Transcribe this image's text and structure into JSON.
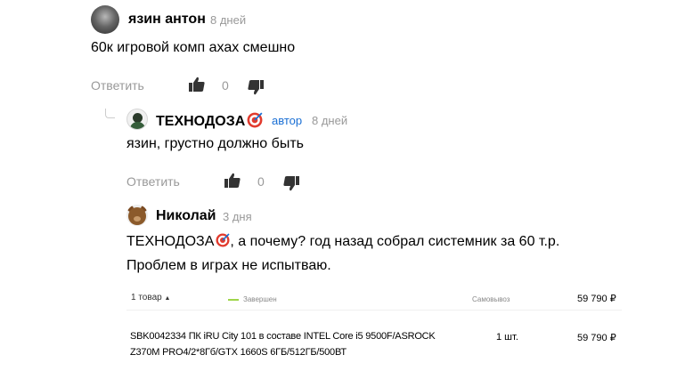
{
  "comments": [
    {
      "author": "язин антон",
      "date": "8 дней",
      "text": "60к игровой комп ахах смешно",
      "reply_label": "Ответить",
      "likes": "0"
    },
    {
      "author": "ТЕХНОДОЗА",
      "badge": "автор",
      "date": "8 дней",
      "text": "язин, грустно должно быть",
      "reply_label": "Ответить",
      "likes": "0"
    },
    {
      "author": "Николай",
      "date": "3 дня",
      "text_line1_prefix": "ТЕХНОДОЗА",
      "text_line1_suffix": ", а почему? год назад собрал системник за 60 т.р.",
      "text_line2": "Проблем в играх не испытваю.",
      "attachment": {
        "summary_count": "1 товар",
        "status": "Завершен",
        "delivery": "Самовывоз",
        "summary_price": "59 790 ₽",
        "item_line1": "SBK0042334 ПК iRU City 101 в составе INTEL Core i5 9500F/ASROCK",
        "item_line2": "Z370M PRO4/2*8Гб/GTX 1660S 6ГБ/512ГБ/500ВТ",
        "item_qty": "1 шт.",
        "item_price": "59 790 ₽"
      }
    }
  ],
  "icons": {
    "like": "thumbs-up-icon",
    "dislike": "thumbs-down-icon",
    "target": "target-emoji-icon"
  },
  "colors": {
    "muted": "#999999",
    "badge": "#1a6fd4",
    "status_green": "#9fd54a",
    "emoji_red": "#e23b2e"
  }
}
